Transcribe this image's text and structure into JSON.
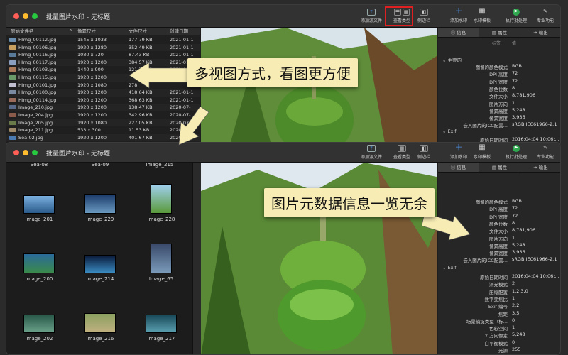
{
  "app_title": "批量图片水印 - 无标题",
  "toolbar": {
    "add_source": "添加源文件",
    "view_type": "查看类型",
    "sidebar": "侧边栏",
    "add_watermark": "添加水印",
    "watermark_template": "水印模板",
    "run_batch": "执行批处理",
    "pro_features": "专业功能"
  },
  "right_tabs": [
    "信息",
    "属性",
    "输出"
  ],
  "meta_header": {
    "key": "标签",
    "value": "值"
  },
  "group_main": "主要的",
  "group_exif": "Exif",
  "meta_main_top": [
    {
      "k": "图像的颜色模式",
      "v": "RGB"
    },
    {
      "k": "DPI 高度",
      "v": "72"
    },
    {
      "k": "DPI 宽度",
      "v": "72"
    },
    {
      "k": "颜色位数",
      "v": "8"
    },
    {
      "k": "文件大小",
      "v": "8,781,906"
    },
    {
      "k": "图片方向",
      "v": "1"
    },
    {
      "k": "像素高度",
      "v": "5,248"
    },
    {
      "k": "像素宽度",
      "v": "3,936"
    },
    {
      "k": "嵌入图片的ICC配置...",
      "v": "sRGB IEC61966-2.1"
    }
  ],
  "meta_top_exif_partial": {
    "k": "原始日期时间",
    "v": "2016:04:04 10:06:..."
  },
  "meta_main_bottom": [
    {
      "k": "图像的颜色模式",
      "v": "RGB"
    },
    {
      "k": "DPI 高度",
      "v": "72"
    },
    {
      "k": "DPI 宽度",
      "v": "72"
    },
    {
      "k": "颜色位数",
      "v": "8"
    },
    {
      "k": "文件大小",
      "v": "8,781,906"
    },
    {
      "k": "图片方向",
      "v": "1"
    },
    {
      "k": "像素高度",
      "v": "5,248"
    },
    {
      "k": "像素宽度",
      "v": "3,936"
    },
    {
      "k": "嵌入图片的ICC配置...",
      "v": "sRGB IEC61966-2.1"
    }
  ],
  "meta_exif": [
    {
      "k": "原始日期时间",
      "v": "2016:04:04 10:06:..."
    },
    {
      "k": "测光模式",
      "v": "2"
    },
    {
      "k": "压缩配置",
      "v": "1,2,3,0"
    },
    {
      "k": "数字变焦比",
      "v": "1"
    },
    {
      "k": "Exif 编号",
      "v": "2.2"
    },
    {
      "k": "焦距",
      "v": "3.5"
    },
    {
      "k": "场景捕捉类型（标...",
      "v": "0"
    },
    {
      "k": "色彩空间",
      "v": "1"
    },
    {
      "k": "Y 方向像素",
      "v": "5,248"
    },
    {
      "k": "白平衡模式",
      "v": "0"
    },
    {
      "k": "光源",
      "v": "255"
    }
  ],
  "list_headers": [
    "原始文件名",
    "像素尺寸",
    "文件尺寸",
    "创建日期"
  ],
  "files": [
    {
      "name": "HImg_00112.jpg",
      "px": "1545 x 1033",
      "size": "177.79 KB",
      "date": "2021-01-1"
    },
    {
      "name": "HImg_00106.jpg",
      "px": "1920 x 1280",
      "size": "352.49 KB",
      "date": "2021-01-1"
    },
    {
      "name": "HImg_00116.jpg",
      "px": "1080 x 720",
      "size": "87.43 KB",
      "date": "2021-01-1"
    },
    {
      "name": "HImg_00117.jpg",
      "px": "1920 x 1200",
      "size": "384.57 KB",
      "date": "2021-01-1"
    },
    {
      "name": "HImg_00103.jpg",
      "px": "1440 x 900",
      "size": "121.73 KB",
      "date": "2021-01-1"
    },
    {
      "name": "HImg_00115.jpg",
      "px": "1920 x 1200",
      "size": "",
      "date": ""
    },
    {
      "name": "HImg_00101.jpg",
      "px": "1920 x 1080",
      "size": "278.",
      "date": ""
    },
    {
      "name": "HImg_00100.jpg",
      "px": "1920 x 1200",
      "size": "418.64 KB",
      "date": "2021-01-1"
    },
    {
      "name": "HImg_00114.jpg",
      "px": "1920 x 1200",
      "size": "368.63 KB",
      "date": "2021-01-1"
    },
    {
      "name": "Image_210.jpg",
      "px": "1920 x 1200",
      "size": "138.47 KB",
      "date": "2020-07-"
    },
    {
      "name": "Image_204.jpg",
      "px": "1920 x 1200",
      "size": "342.96 KB",
      "date": "2020-07-"
    },
    {
      "name": "Image_205.jpg",
      "px": "1920 x 1080",
      "size": "227.05 KB",
      "date": "2020-07-"
    },
    {
      "name": "Image_211.jpg",
      "px": "533 x 300",
      "size": "11.53 KB",
      "date": "2020-07-"
    },
    {
      "name": "Sea-02.jpg",
      "px": "1920 x 1200",
      "size": "401.67 KB",
      "date": "2020-07-"
    }
  ],
  "grid_top_labels": [
    "Sea-08",
    "Sea-09",
    "Image_215"
  ],
  "grid_items": [
    {
      "label": "Image_201"
    },
    {
      "label": "Image_229"
    },
    {
      "label": "Image_228"
    },
    {
      "label": "Image_200"
    },
    {
      "label": "Image_214"
    },
    {
      "label": "Image_65"
    },
    {
      "label": "Image_202"
    },
    {
      "label": "Image_216"
    },
    {
      "label": "Image_217"
    }
  ],
  "callout_1": "多视图方式，看图更方便",
  "callout_2": "图片元数据信息一览无余",
  "colors": {
    "accent": "#4a90e2",
    "callout_bg": "#f7ecb4",
    "highlight": "#e02020"
  }
}
